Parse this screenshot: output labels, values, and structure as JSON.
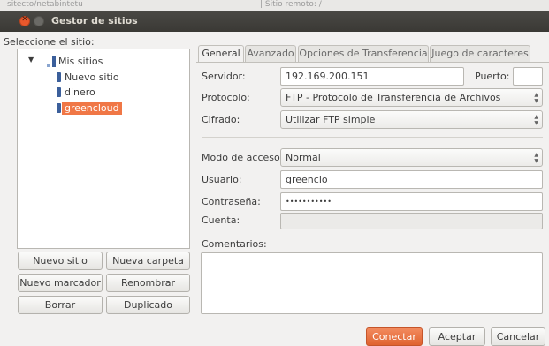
{
  "window": {
    "title": "Gestor de sitios",
    "bg_fragment_left": "sitecto/netabintetu",
    "bg_fragment_right": "| Sitio remoto: /"
  },
  "left": {
    "select_label": "Seleccione el sitio:",
    "tree": {
      "root": "Mis sitios",
      "items": [
        "Nuevo sitio",
        "dinero",
        "greencloud"
      ],
      "selected": "greencloud"
    },
    "buttons": {
      "new_site": "Nuevo sitio",
      "new_folder": "Nueva carpeta",
      "new_bookmark": "Nuevo marcador",
      "rename": "Renombrar",
      "delete": "Borrar",
      "duplicate": "Duplicado"
    }
  },
  "tabs": [
    "General",
    "Avanzado",
    "Opciones de Transferencia",
    "Juego de caracteres"
  ],
  "form": {
    "server_label": "Servidor:",
    "server_value": "192.169.200.151",
    "port_label": "Puerto:",
    "port_value": "",
    "protocol_label": "Protocolo:",
    "protocol_value": "FTP - Protocolo de Transferencia de Archivos",
    "encryption_label": "Cifrado:",
    "encryption_value": "Utilizar FTP simple",
    "logon_label": "Modo de acceso:",
    "logon_value": "Normal",
    "user_label": "Usuario:",
    "user_value": "greenclo",
    "password_label": "Contraseña:",
    "password_value": "•••••••••••",
    "account_label": "Cuenta:",
    "account_value": "",
    "comments_label": "Comentarios:",
    "comments_value": ""
  },
  "footer": {
    "connect": "Conectar",
    "accept": "Aceptar",
    "cancel": "Cancelar"
  },
  "colors": {
    "accent": "#f07746",
    "titlebar": "#3c3b37",
    "window_bg": "#f2f1f0"
  }
}
